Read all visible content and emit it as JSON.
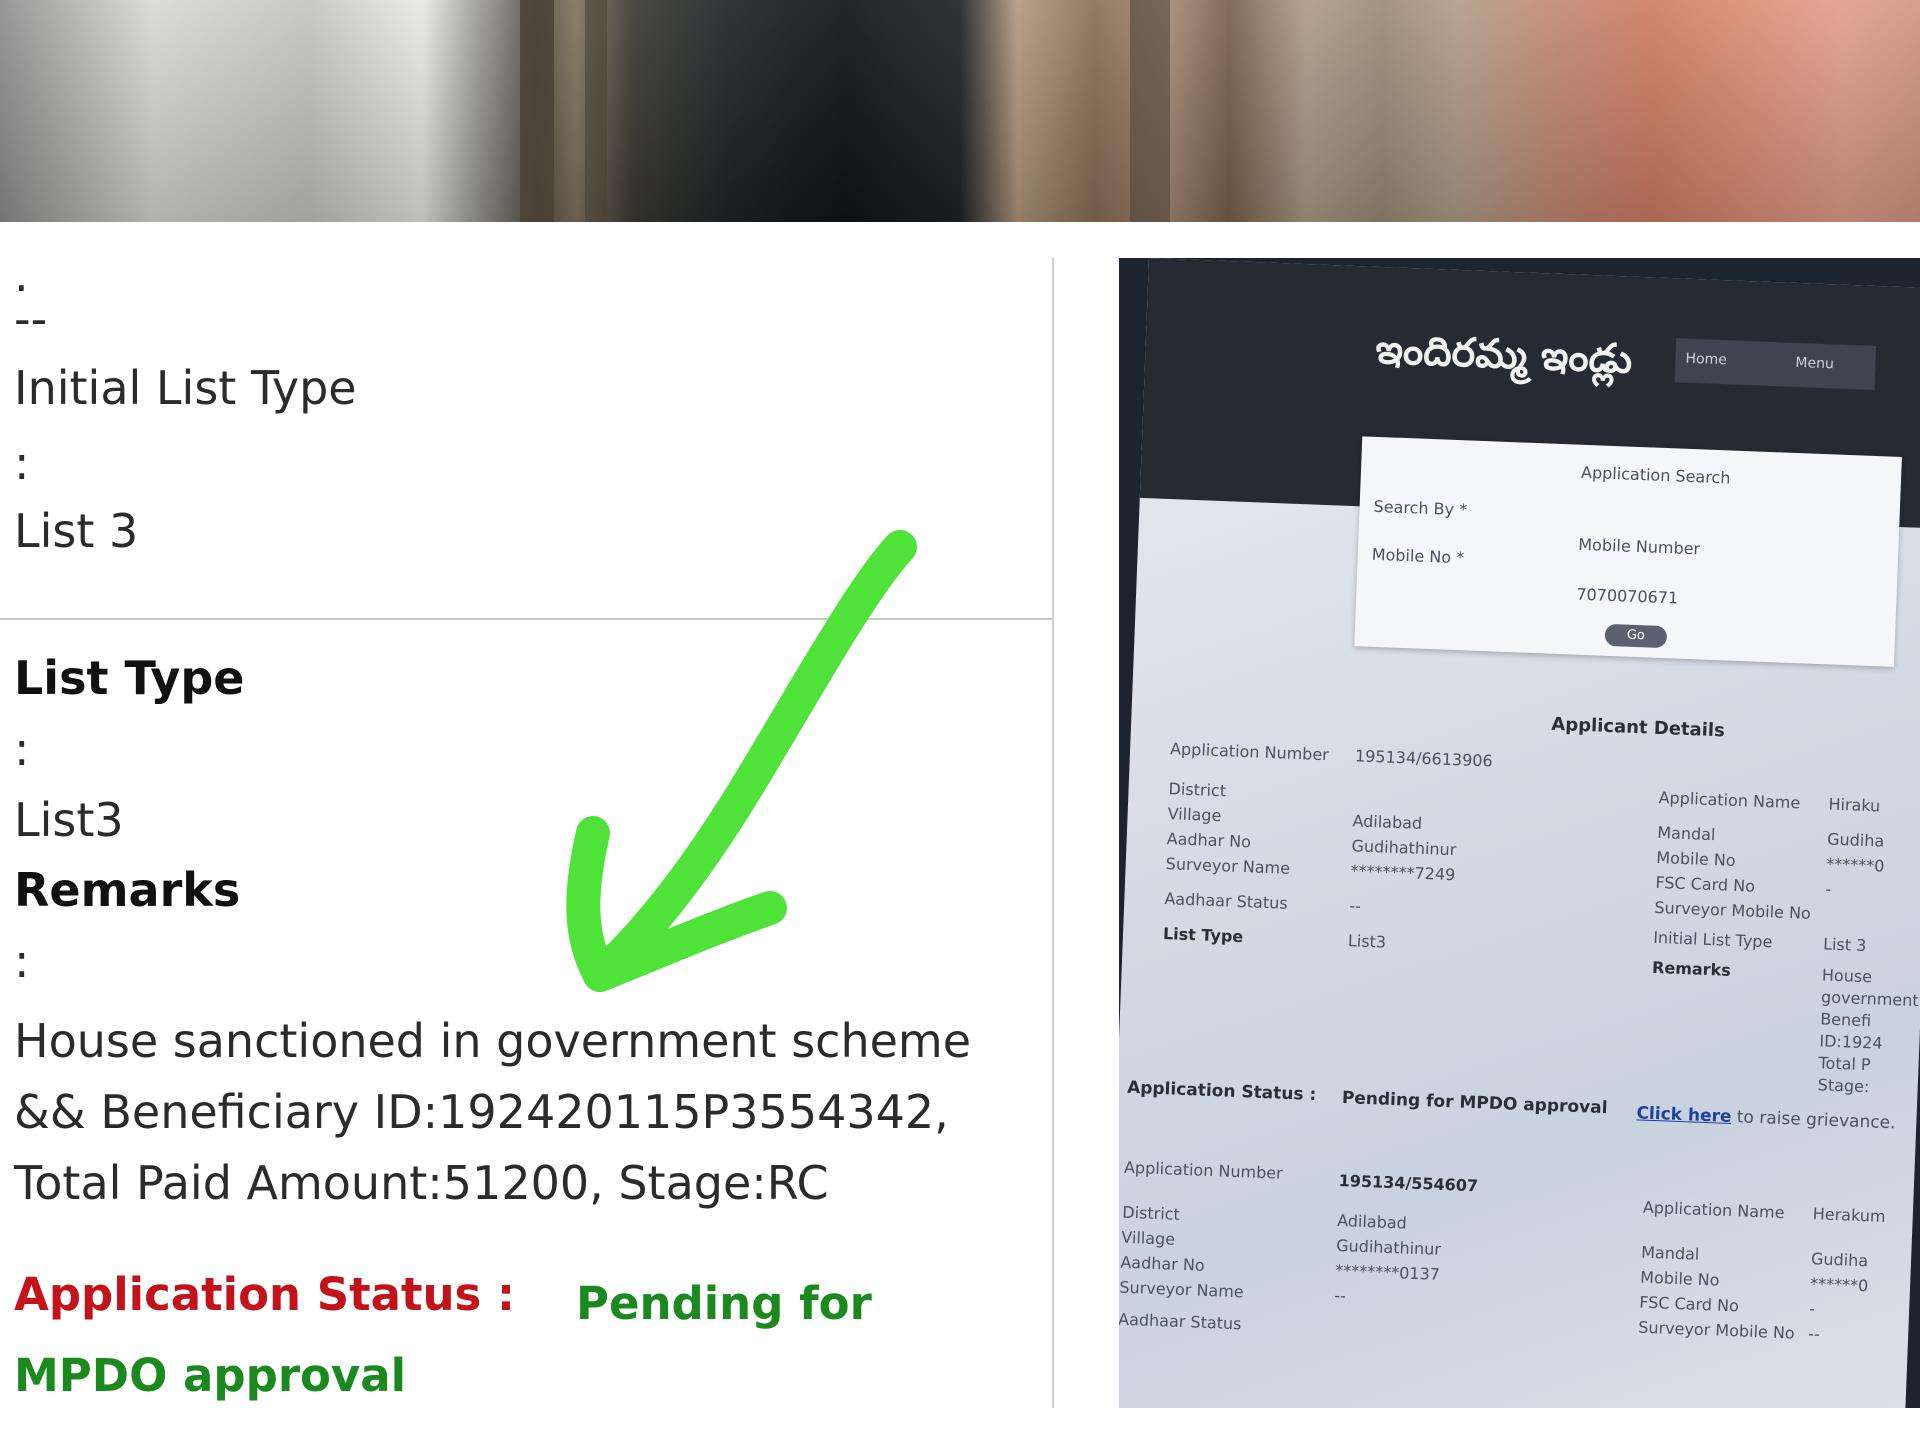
{
  "left_panel": {
    "dot": ".",
    "dashes": "--",
    "initial_list_type_label": "Initial List Type",
    "colon1": ":",
    "initial_list_type_value": "List 3",
    "list_type_label": "List Type",
    "colon2": ":",
    "list_type_value": "List3",
    "remarks_label": "Remarks",
    "colon3": ":",
    "remarks_value": "House sanctioned in government scheme\n&& Beneficiary ID:192420115P3554342,\nTotal Paid Amount:51200, Stage:RC",
    "application_status_label": "Application Status :",
    "application_status_value": "Pending for MPDO approval"
  },
  "annotation": {
    "arrow_color": "#4fe33a",
    "icon": "arrow-down-left-icon"
  },
  "document_photo": {
    "title": "ఇందిరమ్మ ఇండ్లు",
    "menu_home": "Home",
    "menu_item": "Menu",
    "search_title": "Application Search",
    "search_by_label": "Search By *",
    "search_by_value": "Mobile Number",
    "mobile_label": "Mobile No *",
    "mobile_value": "7070070671",
    "go_button": "Go",
    "details_title": "Applicant Details",
    "left_fields": [
      "Application Number",
      "District",
      "Village",
      "Aadhar No",
      "Surveyor Name",
      "Aadhaar Status",
      "List Type"
    ],
    "left_values": [
      "195134/6613906",
      "Adilabad",
      "Gudihathinur",
      "********7249",
      "",
      "--",
      "List3"
    ],
    "right_fields": [
      "Application Name",
      "Mandal",
      "Mobile No",
      "FSC Card No",
      "Surveyor Mobile No",
      "Initial List Type",
      "Remarks"
    ],
    "right_values": [
      "Hiraku",
      "Gudiha",
      "******0",
      "-",
      "",
      "List 3",
      "House government Benefi ID:1924 Total P Stage:"
    ],
    "status_label": "Application Status :",
    "status_value": "Pending for MPDO approval",
    "grievance_link": "Click here",
    "grievance_text": "to raise grievance.",
    "second_left_fields": [
      "Application Number",
      "District",
      "Village",
      "Aadhar No",
      "Surveyor Name",
      "Aadhaar Status"
    ],
    "second_left_values": [
      "195134/554607",
      "Adilabad",
      "Gudihathinur",
      "********0137",
      "--"
    ],
    "second_right_fields": [
      "Application Name",
      "Mandal",
      "Mobile No",
      "FSC Card No",
      "Surveyor Mobile No"
    ],
    "second_right_values": [
      "Herakum",
      "Gudiha",
      "******0",
      "-",
      "--"
    ]
  }
}
